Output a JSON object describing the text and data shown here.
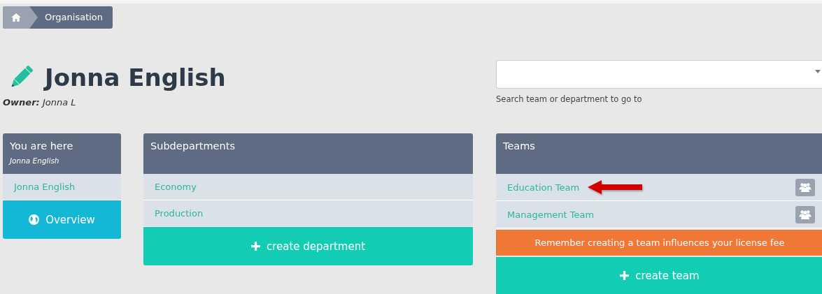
{
  "breadcrumb": {
    "current": "Organisation"
  },
  "title": "Jonna English",
  "owner": {
    "label": "Owner:",
    "value": "Jonna L"
  },
  "search": {
    "hint": "Search team or department to go to"
  },
  "location_panel": {
    "title": "You are here",
    "subtitle": "Jonna English",
    "items": [
      "Jonna English"
    ],
    "button": "Overview"
  },
  "subdepartments_panel": {
    "title": "Subdepartments",
    "items": [
      "Economy",
      "Production"
    ],
    "button": "create department"
  },
  "teams_panel": {
    "title": "Teams",
    "items": [
      {
        "name": "Education Team",
        "highlighted": true
      },
      {
        "name": "Management Team",
        "highlighted": false
      }
    ],
    "notice": "Remember creating a team influences your license fee",
    "button": "create team"
  }
}
